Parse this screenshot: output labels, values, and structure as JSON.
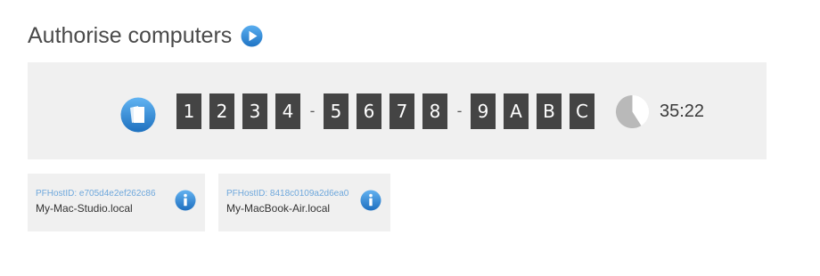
{
  "page": {
    "title": "Authorise computers",
    "accent_color": "#2f86d6"
  },
  "header": {
    "play_icon": "play-circle-icon"
  },
  "code_panel": {
    "app_icon": "cards-app-icon",
    "groups": [
      [
        "1",
        "2",
        "3",
        "4"
      ],
      [
        "5",
        "6",
        "7",
        "8"
      ],
      [
        "9",
        "A",
        "B",
        "C"
      ]
    ],
    "separator": "-",
    "timer": {
      "icon": "countdown-pie-icon",
      "remaining_fraction": 0.59,
      "text": "35:22"
    }
  },
  "hosts": [
    {
      "host_id": "PFHostID: e705d4e2ef262c86",
      "name": "My-Mac-Studio.local",
      "icon": "info-icon"
    },
    {
      "host_id": "PFHostID: 8418c0109a2d6ea0",
      "name": "My-MacBook-Air.local",
      "icon": "info-icon"
    }
  ]
}
